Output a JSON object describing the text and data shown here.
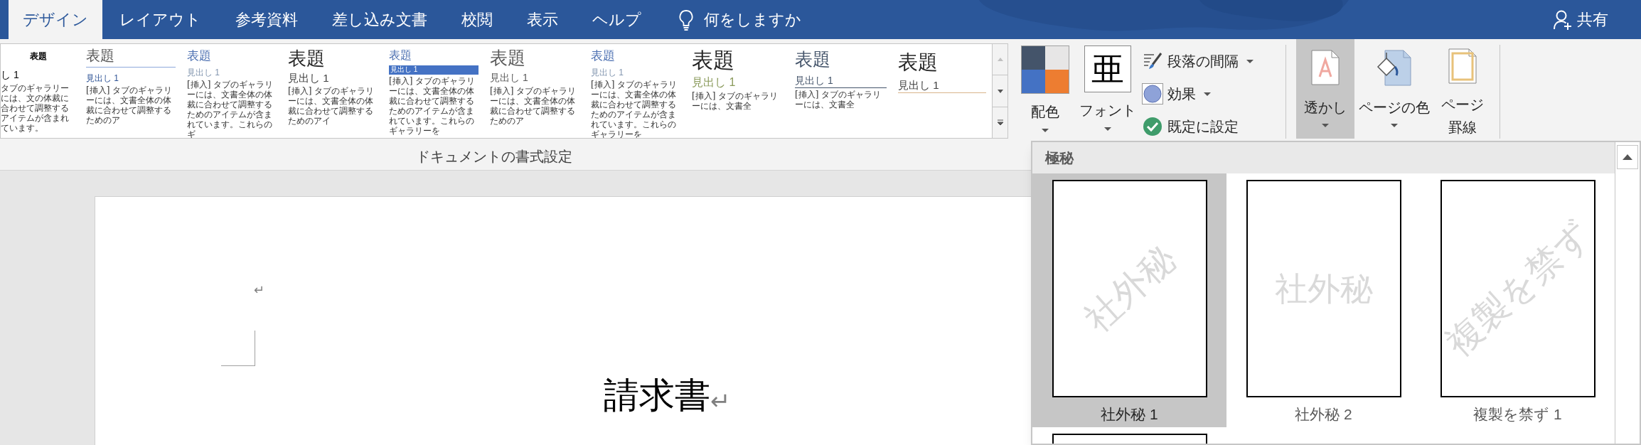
{
  "tabs": [
    {
      "label": "デザイン",
      "selected": true
    },
    {
      "label": "レイアウト",
      "selected": false
    },
    {
      "label": "参考資料",
      "selected": false
    },
    {
      "label": "差し込み文書",
      "selected": false
    },
    {
      "label": "校閲",
      "selected": false
    },
    {
      "label": "表示",
      "selected": false
    },
    {
      "label": "ヘルプ",
      "selected": false
    }
  ],
  "tell_me": {
    "text": "何をしますか"
  },
  "share_button": {
    "label": "共有"
  },
  "style_gallery": {
    "label": "ドキュメントの書式設定",
    "styles": [
      {
        "kind": "classic",
        "title": "表題",
        "heading": "し 1",
        "body": "タブのギャラリーには、文の体裁に合わせて調整するアイテムが含まれています。"
      },
      {
        "kind": "lined",
        "title": "表題",
        "heading": "見出し 1",
        "body": "[挿入] タブのギャラリーには、文書全体の体裁に合わせて調整するためのア"
      },
      {
        "kind": "blue",
        "title": "表題",
        "heading": "見出し 1",
        "body": "[挿入] タブのギャラリーには、文書全体の体裁に合わせて調整するためのアイテムが含まれています。これらのギ"
      },
      {
        "kind": "large",
        "title": "表題",
        "heading": "見出し 1",
        "body": "[挿入] タブのギャラリーには、文書全体の体裁に合わせて調整するためのアイ"
      },
      {
        "kind": "banded",
        "title": "表題",
        "heading": "見出し 1",
        "body": "[挿入] タブのギャラリーには、文書全体の体裁に合わせて調整するためのアイテムが含まれています。これらのギャラリーを"
      },
      {
        "kind": "light",
        "title": "表題",
        "heading": "見出し 1",
        "body": "[挿入] タブのギャラリーには、文書全体の体裁に合わせて調整するためのア"
      },
      {
        "kind": "blue",
        "title": "表題",
        "heading": "見出し 1",
        "body": "[挿入] タブのギャラリーには、文書全体の体裁に合わせて調整するためのアイテムが含まれています。これらのギャラリーを"
      },
      {
        "kind": "olive",
        "title": "表題",
        "heading": "見出し 1",
        "body": "[挿入] タブのギャラリーには、文書全"
      },
      {
        "kind": "underlined",
        "title": "表題",
        "heading": "見出し 1",
        "body": "[挿入] タブのギャラリーには、文書全"
      },
      {
        "kind": "tan",
        "title": "表題",
        "heading": "見出し 1"
      }
    ]
  },
  "theme_buttons": {
    "colors": {
      "label": "配色"
    },
    "fonts": {
      "label": "フォント",
      "sample": "亜"
    }
  },
  "format_buttons": [
    {
      "label": "段落の間隔",
      "has_menu": true
    },
    {
      "label": "効果",
      "has_menu": true
    },
    {
      "label": "既定に設定",
      "has_menu": false
    }
  ],
  "page_background_buttons": [
    {
      "label": "透かし",
      "pressed": true,
      "has_menu": true
    },
    {
      "label": "ページの色",
      "pressed": false,
      "has_menu": true
    },
    {
      "label": "ページ罫線",
      "pressed": false,
      "has_menu": false
    }
  ],
  "document": {
    "paragraphs": [
      {
        "mark": "↵"
      },
      {
        "text": "請求書",
        "mark": "↵"
      }
    ]
  },
  "watermark_gallery": {
    "category": "極秘",
    "items": [
      {
        "label": "社外秘 1",
        "watermark": "社外秘",
        "kind": "diagonal",
        "selected": true
      },
      {
        "label": "社外秘 2",
        "watermark": "社外秘",
        "kind": "horizontal",
        "selected": false
      },
      {
        "label": "複製を禁ず 1",
        "watermark": "複製を禁ず",
        "kind": "diagonal",
        "selected": false
      },
      {
        "selected": false
      }
    ]
  }
}
